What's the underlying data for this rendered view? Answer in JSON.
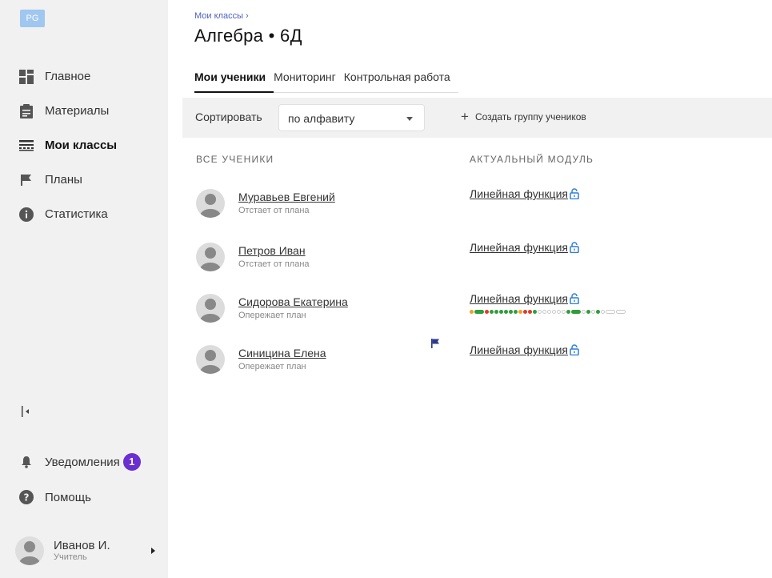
{
  "logo": "PG",
  "sidebar": {
    "items": [
      {
        "label": "Главное",
        "icon": "dashboard-icon"
      },
      {
        "label": "Материалы",
        "icon": "clipboard-icon"
      },
      {
        "label": "Мои классы",
        "icon": "classes-icon",
        "active": true
      },
      {
        "label": "Планы",
        "icon": "flag-icon"
      },
      {
        "label": "Статистика",
        "icon": "info-icon"
      }
    ],
    "notifications_label": "Уведомления",
    "notifications_count": "1",
    "help_label": "Помощь",
    "user_name": "Иванов И.",
    "user_role": "Учитель"
  },
  "header": {
    "breadcrumb": "Мои классы",
    "title": "Алгебра • 6Д"
  },
  "tabs": [
    {
      "label": "Мои ученики",
      "active": true
    },
    {
      "label": "Мониторинг"
    },
    {
      "label": "Контрольная работа"
    }
  ],
  "toolbar": {
    "sort_label": "Сортировать",
    "sort_value": "по алфавиту",
    "create_group_label": "Создать группу учеников"
  },
  "columns": {
    "students": "ВСЕ УЧЕНИКИ",
    "module": "АКТУАЛЬНЫЙ МОДУЛЬ"
  },
  "students": [
    {
      "name": "Муравьев Евгений",
      "status": "Отстает от плана",
      "module": "Линейная функция"
    },
    {
      "name": "Петров Иван",
      "status": "Отстает от плана",
      "module": "Линейная функция"
    },
    {
      "name": "Сидорова Екатерина",
      "status": "Опережает план",
      "module": "Линейная функция"
    },
    {
      "name": "Синицина Елена",
      "status": "Опережает план",
      "module": "Линейная функция"
    }
  ],
  "colors": {
    "accent": "#4a5fc2",
    "badge": "#6a2fd0",
    "lock": "#2f7fd8",
    "flag": "#2b3a8c",
    "progress_green": "#2e9e3a",
    "progress_red": "#e03a2a",
    "progress_orange": "#f0a020"
  }
}
